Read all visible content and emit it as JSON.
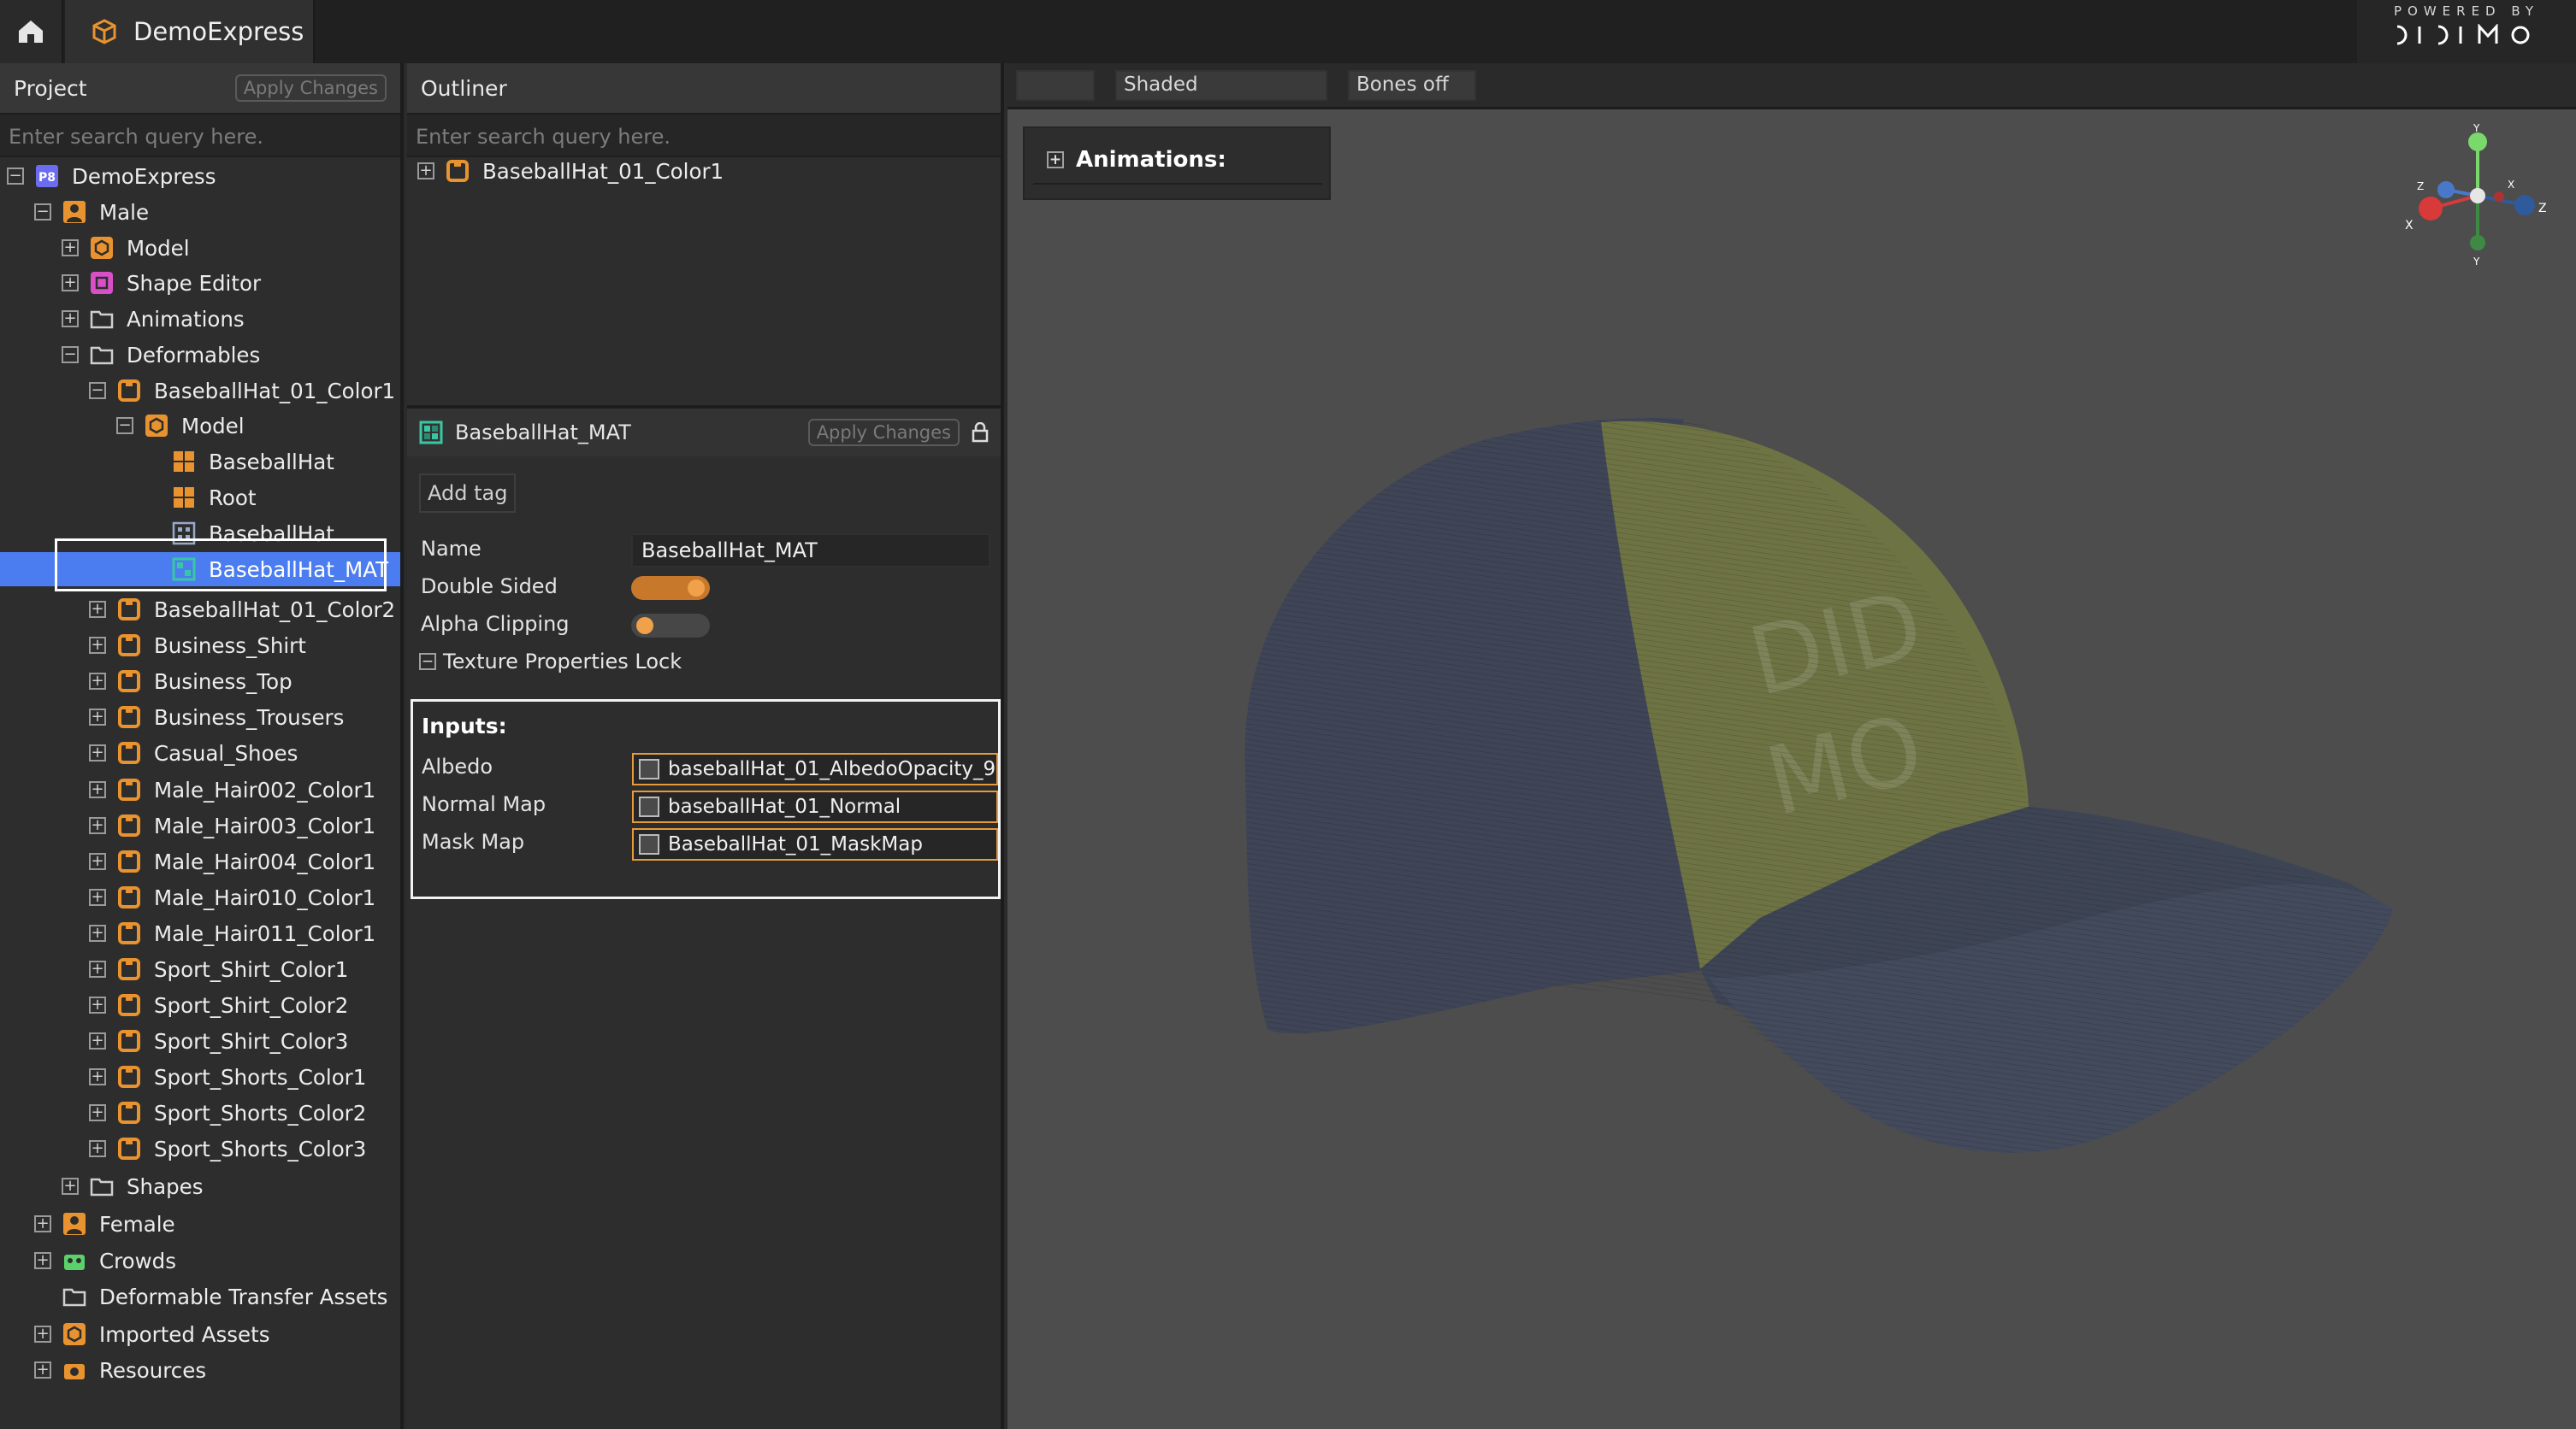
{
  "top_bar": {
    "project_tab": "DemoExpress",
    "brand_powered": "POWERED BY",
    "brand_name": "DIDIMO"
  },
  "project_panel": {
    "title": "Project",
    "apply_label": "Apply Changes",
    "search_placeholder": "Enter search query here.",
    "tree": [
      {
        "label": "DemoExpress",
        "exp": "-",
        "icon": "project-icon"
      },
      {
        "label": "Male",
        "exp": "-",
        "icon": "person-icon"
      },
      {
        "label": "Model",
        "exp": "+",
        "icon": "model-icon"
      },
      {
        "label": "Shape Editor",
        "exp": "+",
        "icon": "shape-editor-icon"
      },
      {
        "label": "Animations",
        "exp": "+",
        "icon": "folder-icon"
      },
      {
        "label": "Deformables",
        "exp": "-",
        "icon": "folder-icon"
      },
      {
        "label": "BaseballHat_01_Color1",
        "exp": "-",
        "icon": "shirt-icon"
      },
      {
        "label": "Model",
        "exp": "-",
        "icon": "model-icon"
      },
      {
        "label": "BaseballHat",
        "exp": "",
        "icon": "mesh-icon"
      },
      {
        "label": "Root",
        "exp": "",
        "icon": "mesh-icon"
      },
      {
        "label": "BaseballHat",
        "exp": "",
        "icon": "texture-icon"
      },
      {
        "label": "BaseballHat_MAT",
        "exp": "",
        "icon": "material-icon"
      },
      {
        "label": "BaseballHat_01_Color2",
        "exp": "+",
        "icon": "shirt-icon"
      },
      {
        "label": "Business_Shirt",
        "exp": "+",
        "icon": "shirt-icon"
      },
      {
        "label": "Business_Top",
        "exp": "+",
        "icon": "shirt-icon"
      },
      {
        "label": "Business_Trousers",
        "exp": "+",
        "icon": "shirt-icon"
      },
      {
        "label": "Casual_Shoes",
        "exp": "+",
        "icon": "shirt-icon"
      },
      {
        "label": "Male_Hair002_Color1",
        "exp": "+",
        "icon": "shirt-icon"
      },
      {
        "label": "Male_Hair003_Color1",
        "exp": "+",
        "icon": "shirt-icon"
      },
      {
        "label": "Male_Hair004_Color1",
        "exp": "+",
        "icon": "shirt-icon"
      },
      {
        "label": "Male_Hair010_Color1",
        "exp": "+",
        "icon": "shirt-icon"
      },
      {
        "label": "Male_Hair011_Color1",
        "exp": "+",
        "icon": "shirt-icon"
      },
      {
        "label": "Sport_Shirt_Color1",
        "exp": "+",
        "icon": "shirt-icon"
      },
      {
        "label": "Sport_Shirt_Color2",
        "exp": "+",
        "icon": "shirt-icon"
      },
      {
        "label": "Sport_Shirt_Color3",
        "exp": "+",
        "icon": "shirt-icon"
      },
      {
        "label": "Sport_Shorts_Color1",
        "exp": "+",
        "icon": "shirt-icon"
      },
      {
        "label": "Sport_Shorts_Color2",
        "exp": "+",
        "icon": "shirt-icon"
      },
      {
        "label": "Sport_Shorts_Color3",
        "exp": "+",
        "icon": "shirt-icon"
      },
      {
        "label": "Shapes",
        "exp": "+",
        "icon": "folder-icon"
      },
      {
        "label": "Female",
        "exp": "+",
        "icon": "person-icon"
      },
      {
        "label": "Crowds",
        "exp": "+",
        "icon": "crowds-icon"
      },
      {
        "label": "Deformable Transfer Assets",
        "exp": "",
        "icon": "folder-icon"
      },
      {
        "label": "Imported Assets",
        "exp": "+",
        "icon": "model-icon"
      },
      {
        "label": "Resources",
        "exp": "+",
        "icon": "camera-icon"
      }
    ]
  },
  "outliner": {
    "title": "Outliner",
    "search_placeholder": "Enter search query here.",
    "item": "BaseballHat_01_Color1"
  },
  "material": {
    "title": "BaseballHat_MAT",
    "apply_label": "Apply Changes",
    "add_tag": "Add tag",
    "name_label": "Name",
    "name_value": "BaseballHat_MAT",
    "double_sided_label": "Double Sided",
    "double_sided": true,
    "alpha_clipping_label": "Alpha Clipping",
    "alpha_clipping": false,
    "texture_lock_label": "Texture Properties Lock",
    "inputs_title": "Inputs:",
    "inputs": [
      {
        "label": "Albedo",
        "value": "baseballHat_01_AlbedoOpacity_9"
      },
      {
        "label": "Normal Map",
        "value": "baseballHat_01_Normal"
      },
      {
        "label": "Mask Map",
        "value": "BaseballHat_01_MaskMap"
      }
    ]
  },
  "viewport": {
    "shading_mode": "Shaded",
    "bones_mode": "Bones off",
    "animations_label": "Animations:",
    "gizmo": {
      "y": "Y",
      "x": "X",
      "z": "Z"
    }
  },
  "colors": {
    "accent": "#4c7df0",
    "orange": "#e8932f",
    "hat_gray": "#3f4556",
    "hat_olive": "#6e7344"
  }
}
